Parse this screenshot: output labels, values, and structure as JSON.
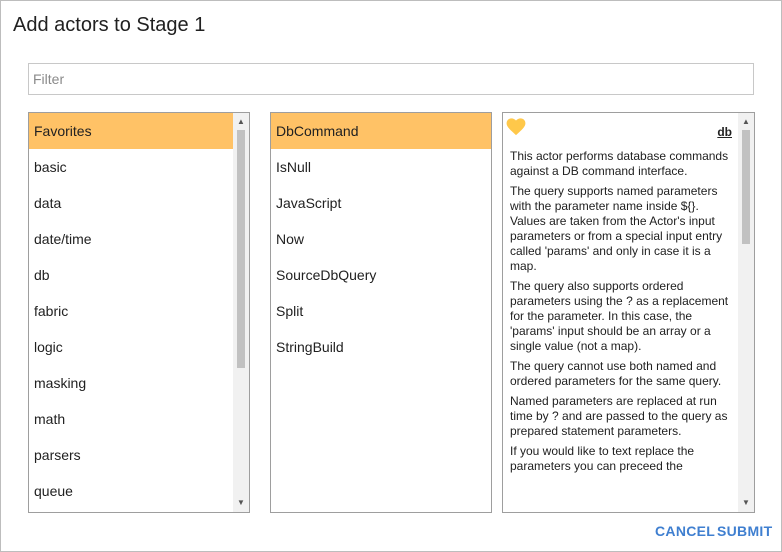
{
  "dialog": {
    "title": "Add actors to Stage 1"
  },
  "filter": {
    "placeholder": "Filter",
    "value": ""
  },
  "categories": {
    "selected": "Favorites",
    "items": [
      "Favorites",
      "basic",
      "data",
      "date/time",
      "db",
      "fabric",
      "logic",
      "masking",
      "math",
      "parsers",
      "queue"
    ]
  },
  "actors": {
    "selected": "DbCommand",
    "items": [
      "DbCommand",
      "IsNull",
      "JavaScript",
      "Now",
      "SourceDbQuery",
      "Split",
      "StringBuild"
    ]
  },
  "details": {
    "favorite_icon": "heart-icon",
    "favorite_color": "#ffc84a",
    "category_link": "db",
    "paragraphs": [
      "This actor performs database commands against a DB command interface.",
      "The query supports named parameters with the parameter name inside ${}. Values are taken from the Actor's input parameters or from a special input entry called 'params' and only in case it is a map.",
      "The query also supports ordered parameters using the ? as a replacement for the parameter. In this case, the 'params' input should be an array or a single value (not a map).",
      "The query cannot use both named and ordered parameters for the same query.",
      "Named parameters are replaced at run time by ? and are passed to the query as prepared statement parameters.",
      "If you would like to text replace the parameters you can preceed the"
    ]
  },
  "buttons": {
    "cancel": "CANCEL",
    "submit": "SUBMIT"
  },
  "colors": {
    "selection": "#ffc266",
    "accent": "#3f7fd0"
  }
}
